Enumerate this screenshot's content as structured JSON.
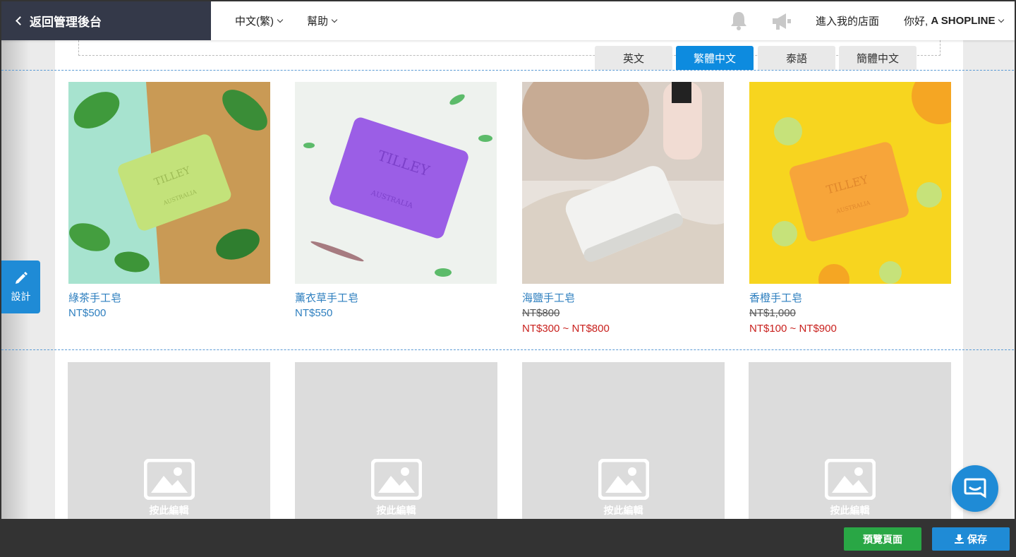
{
  "header": {
    "back_label": "返回管理後台",
    "language_menu": "中文(繁)",
    "help_menu": "幫助",
    "store_link": "進入我的店面",
    "greeting_prefix": "你好, ",
    "greeting_name": "A SHOPLINE"
  },
  "language_tabs": [
    {
      "label": "英文",
      "active": false
    },
    {
      "label": "繁體中文",
      "active": true
    },
    {
      "label": "泰語",
      "active": false
    },
    {
      "label": "簡體中文",
      "active": false
    }
  ],
  "products": [
    {
      "name": "綠茶手工皂",
      "price": "NT$500",
      "image": "green-soap"
    },
    {
      "name": "薰衣草手工皂",
      "price": "NT$550",
      "image": "purple-soap"
    },
    {
      "name": "海鹽手工皂",
      "original_price": "NT$800",
      "sale_price": "NT$300 ~ NT$800",
      "image": "white-soap"
    },
    {
      "name": "香橙手工皂",
      "original_price": "NT$1,000",
      "sale_price": "NT$100 ~ NT$900",
      "image": "orange-soap"
    }
  ],
  "placeholders": [
    {
      "label": "按此編輯"
    },
    {
      "label": "按此編輯"
    },
    {
      "label": "按此編輯"
    },
    {
      "label": "按此編輯"
    }
  ],
  "sidebar": {
    "design_label": "設計"
  },
  "footer": {
    "preview_label": "預覽頁面",
    "save_label": "保存"
  },
  "colors": {
    "accent": "#1f8bd6",
    "preview": "#29a745",
    "sale": "#c9211e",
    "link": "#2e7fbf",
    "nav_dark": "#343949"
  }
}
